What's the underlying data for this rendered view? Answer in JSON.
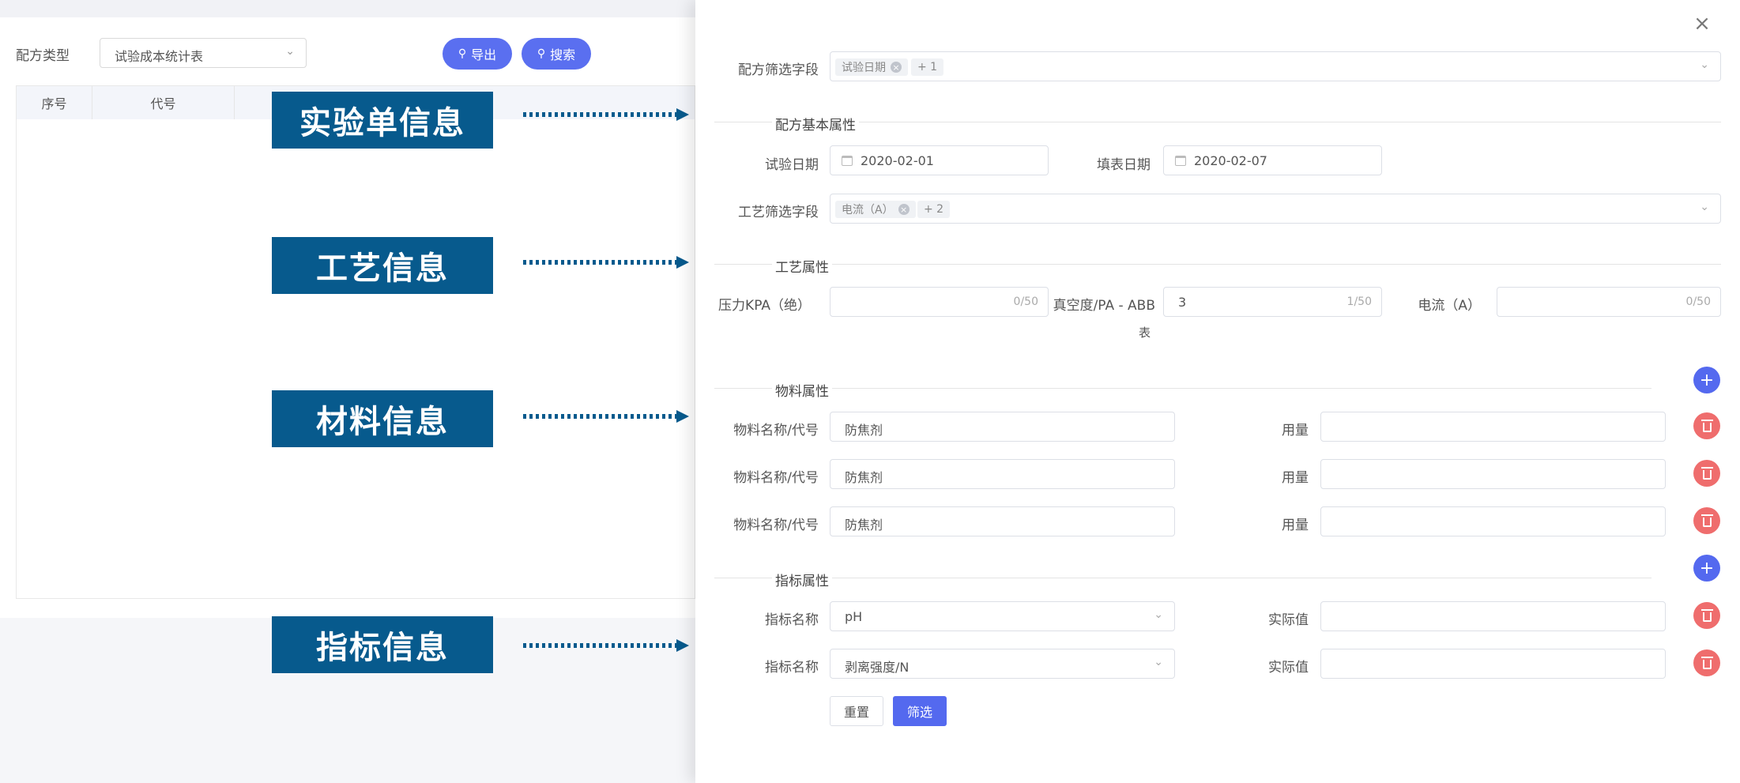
{
  "background": {
    "filter_label": "配方类型",
    "filter_value": "试验成本统计表",
    "export_label": "导出",
    "search_label": "搜索",
    "table_headers": [
      "序号",
      "代号"
    ]
  },
  "banners": [
    "实验单信息",
    "工艺信息",
    "材料信息",
    "指标信息"
  ],
  "colors": {
    "primary": "#5469ef",
    "danger": "#ef6d6d",
    "banner": "#075a8d"
  },
  "drawer": {
    "recipe_filter": {
      "label": "配方筛选字段",
      "tag": "试验日期",
      "more": "+ 1"
    },
    "basic_section": "配方基本属性",
    "test_date": {
      "label": "试验日期",
      "value": "2020-02-01"
    },
    "fill_date": {
      "label": "填表日期",
      "value": "2020-02-07"
    },
    "process_filter": {
      "label": "工艺筛选字段",
      "tag": "电流（A）",
      "more": "+ 2"
    },
    "process_section": "工艺属性",
    "process_fields": [
      {
        "label": "压力KPA（绝）",
        "value": "",
        "count": "0/50"
      },
      {
        "label": "真空度/PA - ABB",
        "label2": "表",
        "value": "3",
        "count": "1/50"
      },
      {
        "label": "电流（A）",
        "value": "",
        "count": "0/50"
      }
    ],
    "material_section": "物料属性",
    "materials": [
      {
        "name_label": "物料名称/代号",
        "name": "防焦剂",
        "qty_label": "用量",
        "qty": ""
      },
      {
        "name_label": "物料名称/代号",
        "name": "防焦剂",
        "qty_label": "用量",
        "qty": ""
      },
      {
        "name_label": "物料名称/代号",
        "name": "防焦剂",
        "qty_label": "用量",
        "qty": ""
      }
    ],
    "indicator_section": "指标属性",
    "indicators": [
      {
        "name_label": "指标名称",
        "name": "pH",
        "actual_label": "实际值",
        "actual": ""
      },
      {
        "name_label": "指标名称",
        "name": "剥离强度/N",
        "actual_label": "实际值",
        "actual": ""
      }
    ],
    "reset_label": "重置",
    "filter_label": "筛选"
  }
}
